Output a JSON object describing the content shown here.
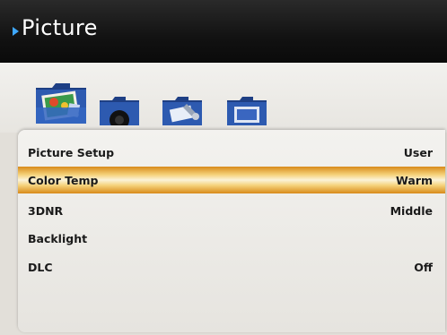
{
  "header": {
    "title": "Picture"
  },
  "icons": [
    "picture-folder-icon",
    "sound-folder-icon",
    "setup-folder-icon",
    "screen-folder-icon"
  ],
  "menu": [
    {
      "label": "Picture Setup",
      "value": "User",
      "highlighted": false
    },
    {
      "label": "Color Temp",
      "value": "Warm",
      "highlighted": true
    },
    {
      "label": "3DNR",
      "value": "Middle",
      "highlighted": false
    },
    {
      "label": "Backlight",
      "value": "",
      "highlighted": false
    },
    {
      "label": "DLC",
      "value": "Off",
      "highlighted": false
    }
  ],
  "colors": {
    "accent": "#3fa8ff",
    "highlight": "#e8a43a",
    "header_bg": "#121212"
  }
}
